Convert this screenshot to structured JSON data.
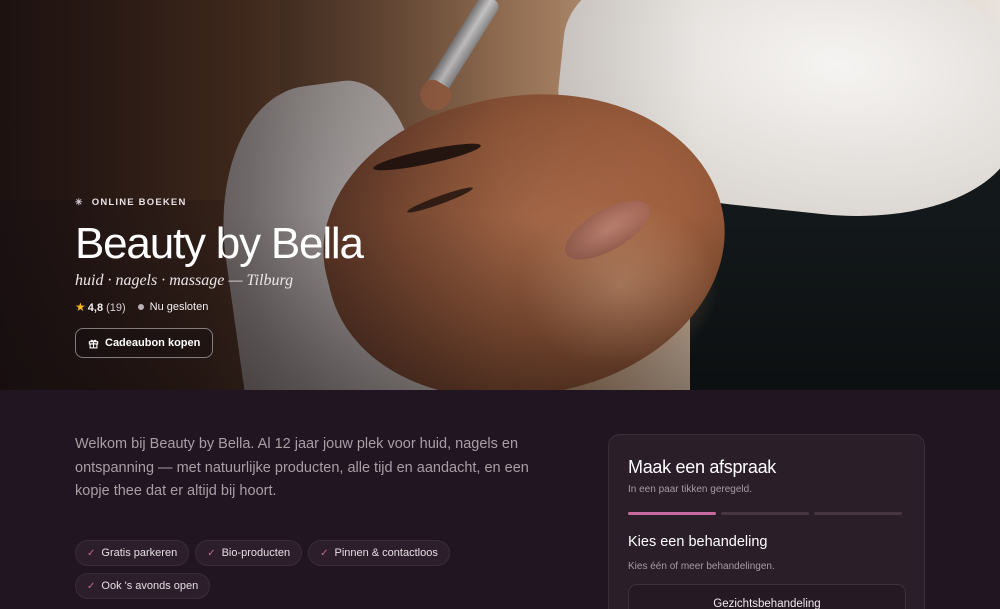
{
  "hero": {
    "eyebrow": "ONLINE BOEKEN",
    "title": "Beauty by Bella",
    "subtitle": "huid · nagels · massage — Tilburg",
    "rating": "4,8",
    "review_count": "(19)",
    "status": "Nu gesloten",
    "gift_button": "Cadeaubon kopen"
  },
  "intro": {
    "text": "Welkom bij Beauty by Bella. Al 12 jaar jouw plek voor huid, nagels en ontspanning — met natuurlijke producten, alle tijd en aandacht, en een kopje thee dat er altijd bij hoort."
  },
  "features": [
    "Gratis parkeren",
    "Bio-producten",
    "Pinnen & contactloos",
    "Ook 's avonds open"
  ],
  "booking": {
    "title": "Maak een afspraak",
    "subtitle": "In een paar tikken geregeld.",
    "steps_total": 3,
    "current_step": 1,
    "section_title": "Kies een behandeling",
    "section_hint": "Kies één of meer behandelingen.",
    "first_option": "Gezichtsbehandeling"
  },
  "colors": {
    "background": "#201520",
    "accent": "#c86aa0",
    "star": "#f4b321"
  }
}
